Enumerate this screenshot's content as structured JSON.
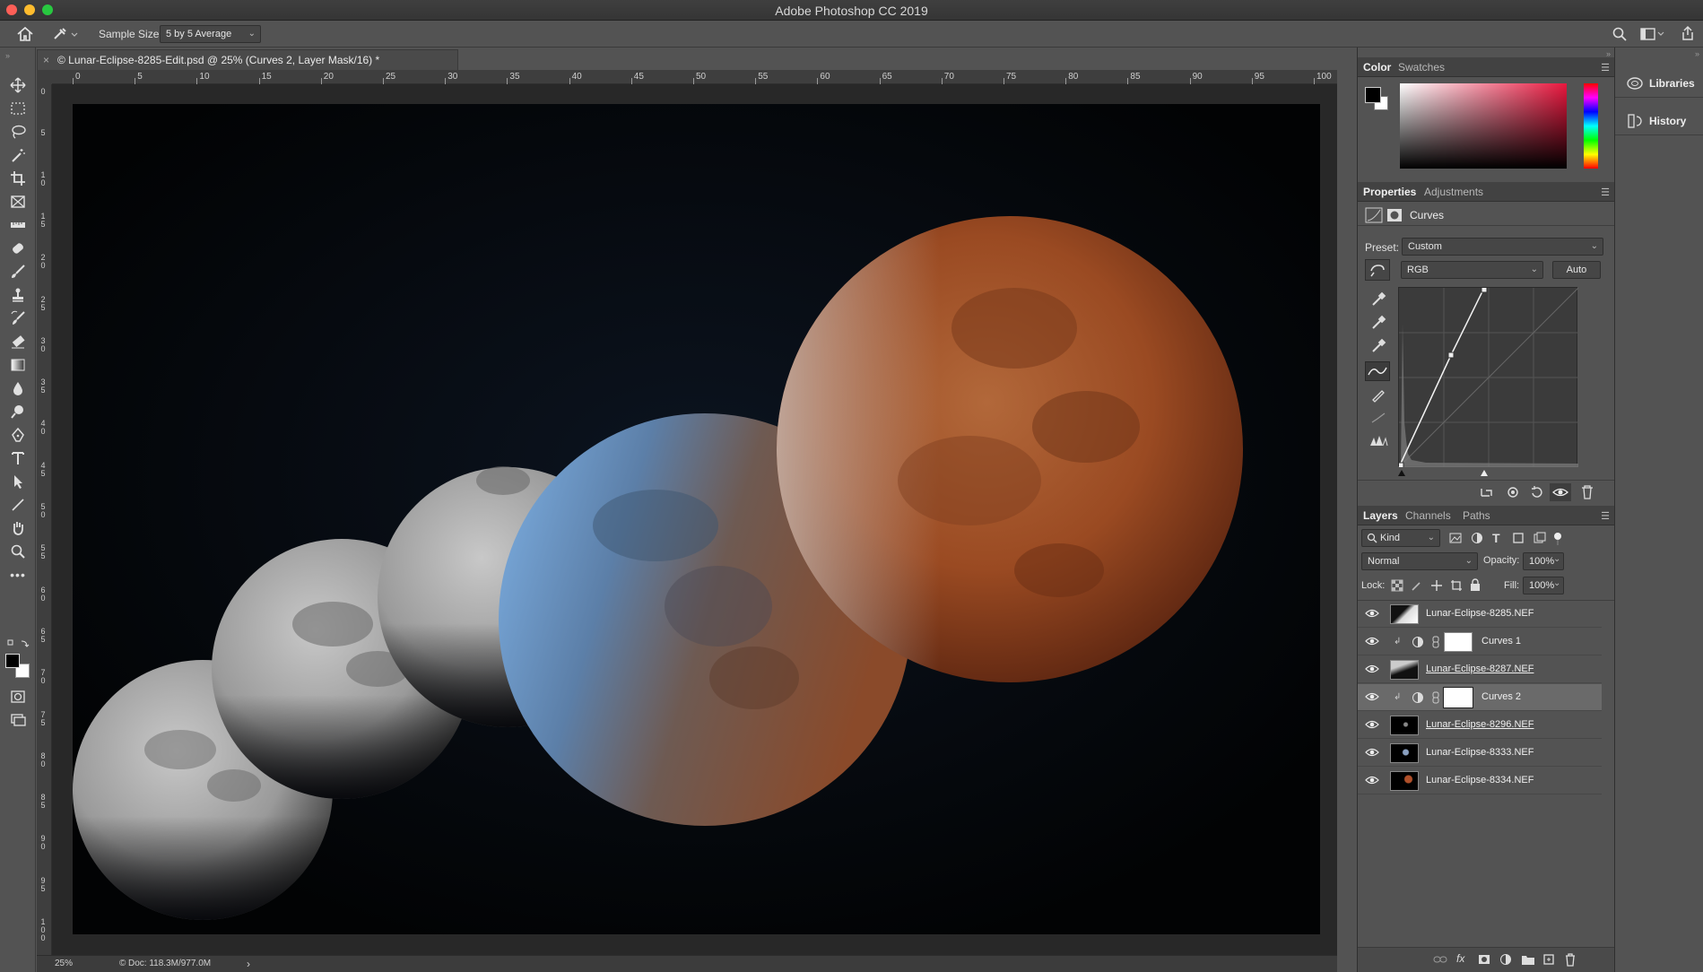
{
  "app": {
    "title": "Adobe Photoshop CC 2019",
    "colors": {
      "close": "#fe5f57",
      "minimize": "#febc2e",
      "maximize": "#28c840"
    }
  },
  "options": {
    "sample_size_label": "Sample Size:",
    "sample_size_value": "5 by 5 Average"
  },
  "document": {
    "tab_close": "×",
    "tab_title": "© Lunar-Eclipse-8285-Edit.psd @ 25% (Curves 2, Layer Mask/16) *"
  },
  "ruler": {
    "horizontal": [
      "0",
      "5",
      "10",
      "15",
      "20",
      "25",
      "30",
      "35",
      "40",
      "45",
      "50",
      "55",
      "60",
      "65",
      "70",
      "75",
      "80",
      "85",
      "90",
      "95",
      "100"
    ],
    "vertical": [
      "0",
      "5",
      "10",
      "15",
      "20",
      "25",
      "30",
      "35",
      "40",
      "45",
      "50",
      "55",
      "60",
      "65",
      "70",
      "75",
      "80",
      "85",
      "90",
      "95",
      "100"
    ]
  },
  "status": {
    "zoom": "25%",
    "doc": "Doc: 118.3M/977.0M",
    "arrow": "›"
  },
  "color_panel": {
    "tabs": [
      "Color",
      "Swatches"
    ]
  },
  "properties_panel": {
    "tabs": [
      "Properties",
      "Adjustments"
    ],
    "adjustment_name": "Curves",
    "preset_label": "Preset:",
    "preset_value": "Custom",
    "channel_value": "RGB",
    "auto_label": "Auto"
  },
  "layers_panel": {
    "tabs": [
      "Layers",
      "Channels",
      "Paths"
    ],
    "filter_kind": "Kind",
    "blend_mode": "Normal",
    "opacity_label": "Opacity:",
    "opacity_value": "100%",
    "lock_label": "Lock:",
    "fill_label": "Fill:",
    "fill_value": "100%",
    "layers": [
      {
        "name": "Lunar-Eclipse-8285.NEF",
        "type": "image"
      },
      {
        "name": "Curves 1",
        "type": "adjustment"
      },
      {
        "name": "Lunar-Eclipse-8287.NEF",
        "type": "image"
      },
      {
        "name": "Curves 2",
        "type": "adjustment",
        "selected": true
      },
      {
        "name": "Lunar-Eclipse-8296.NEF",
        "type": "image"
      },
      {
        "name": "Lunar-Eclipse-8333.NEF",
        "type": "image"
      },
      {
        "name": "Lunar-Eclipse-8334.NEF",
        "type": "image"
      }
    ]
  },
  "side_panel": {
    "libraries": "Libraries",
    "history": "History"
  }
}
